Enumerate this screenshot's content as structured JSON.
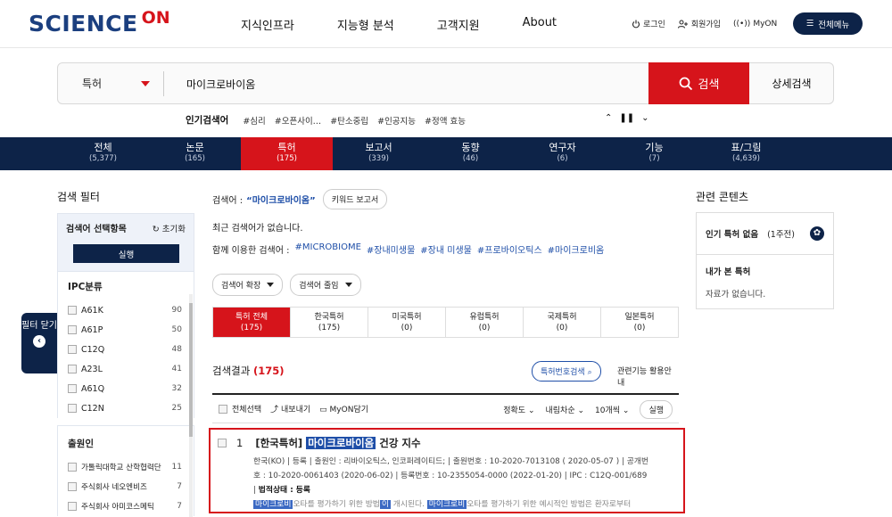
{
  "header": {
    "logo_main": "SCIENCE",
    "logo_accent": "ON",
    "nav": [
      "지식인프라",
      "지능형 분석",
      "고객지원",
      "About"
    ],
    "util": {
      "login": "로그인",
      "signup": "회원가입",
      "myon": "MyON"
    },
    "all_menu": "전체메뉴"
  },
  "search": {
    "scope": "특허",
    "query": "마이크로바이옴",
    "search_button": "검색",
    "advanced_button": "상세검색"
  },
  "popular": {
    "label": "인기검색어",
    "items": [
      "#심리",
      "#오픈사이…",
      "#탄소중립",
      "#인공지능",
      "#정액 효능"
    ]
  },
  "tabs": [
    {
      "label": "전체",
      "count": "(5,377)"
    },
    {
      "label": "논문",
      "count": "(165)"
    },
    {
      "label": "특허",
      "count": "(175)"
    },
    {
      "label": "보고서",
      "count": "(339)"
    },
    {
      "label": "동향",
      "count": "(46)"
    },
    {
      "label": "연구자",
      "count": "(6)"
    },
    {
      "label": "기능",
      "count": "(7)"
    },
    {
      "label": "표/그림",
      "count": "(4,639)"
    }
  ],
  "filter": {
    "title": "검색 필터",
    "select_label": "검색어 선택항목",
    "reset": "초기화",
    "run": "실행",
    "ipc": {
      "label": "IPC분류",
      "items": [
        {
          "code": "A61K",
          "count": "90"
        },
        {
          "code": "A61P",
          "count": "50"
        },
        {
          "code": "C12Q",
          "count": "48"
        },
        {
          "code": "A23L",
          "count": "41"
        },
        {
          "code": "A61Q",
          "count": "32"
        },
        {
          "code": "C12N",
          "count": "25"
        }
      ]
    },
    "applicant": {
      "label": "출원인",
      "items": [
        {
          "name": "가톨릭대학교 산학협력단",
          "count": "11"
        },
        {
          "name": "주식회사 네오엔비즈",
          "count": "7"
        },
        {
          "name": "주식회사 아미코스메틱",
          "count": "7"
        }
      ]
    },
    "close_label": "필터 닫기",
    "close_arrow": "‹"
  },
  "main": {
    "query_label": "검색어 :",
    "query": "“마이크로바이옴”",
    "keyword_report": "키워드 보고서",
    "recent": "최근 검색어가 없습니다.",
    "together_label": "함께 이용한 검색어 :",
    "together": [
      "#MICROBIOME",
      "#장내미생물",
      "#장내 미생물",
      "#프로바이오틱스",
      "#마이크로비옴"
    ],
    "expand": "검색어 확장",
    "narrow": "검색어 줄임",
    "subtabs": [
      {
        "label": "특허 전체",
        "count": "(175)"
      },
      {
        "label": "한국특허",
        "count": "(175)"
      },
      {
        "label": "미국특허",
        "count": "(0)"
      },
      {
        "label": "유럽특허",
        "count": "(0)"
      },
      {
        "label": "국제특허",
        "count": "(0)"
      },
      {
        "label": "일본특허",
        "count": "(0)"
      }
    ],
    "results_label": "검색결과",
    "results_count": "(175)",
    "patent_search": "특허번호검색",
    "guide": "관련기능 활용안내",
    "toolbar": {
      "select_all": "전체선택",
      "export": "내보내기",
      "myon": "MyON담기",
      "sort": "정확도",
      "order": "내림차순",
      "per_page": "10개씩",
      "run": "실행"
    },
    "result": {
      "num": "1",
      "prefix": "[한국특허]",
      "title_hl": "마이크로바이옴",
      "title_rest": "건강 지수",
      "meta1": "한국(KO) | 등록 | 출원인 : 리바이오틱스, 인코퍼레이티드; | 출원번호 : 10-2020-7013108 ( 2020-05-07 ) | 공개번",
      "meta2": "호 : 10-2020-0061403 (2020-06-02) | 등록번호 : 10-2355054-0000 (2022-01-20) | IPC : C12Q-001/689",
      "status_label": "법적상태 : 등록",
      "abs_hl1": "마이크로비",
      "abs_t1": "오타를 평가하기 위한 방법",
      "abs_hl2": "이",
      "abs_t2": " 개시된다. ",
      "abs_hl3": "마이크로비",
      "abs_t3": "오타를 평가하기 위한 예시적인 방법은 환자로부터"
    }
  },
  "related": {
    "title": "관련 콘텐츠",
    "popular_patent": "인기 특허 없음",
    "week": "(1주전)",
    "viewed": "내가 본 특허",
    "empty": "자료가 없습니다."
  }
}
